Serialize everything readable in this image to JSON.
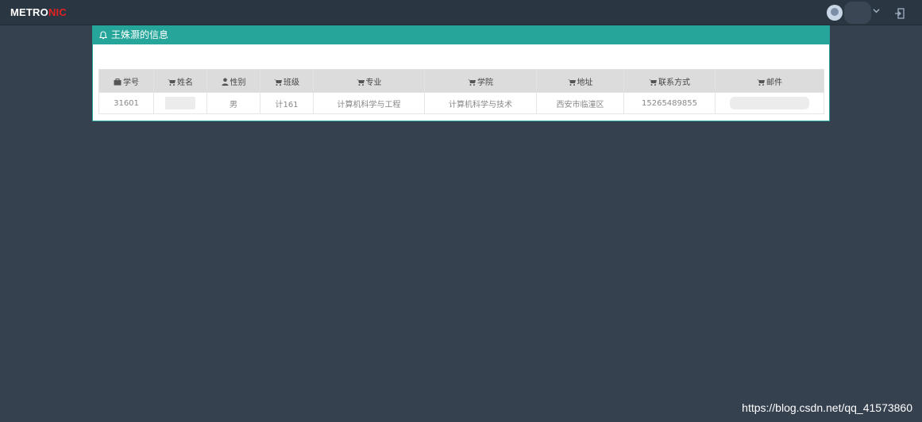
{
  "brand": {
    "logo_part1": "METRO",
    "logo_part2": "NIC",
    "accent_color": "#e02222"
  },
  "header": {
    "avatar_icon": "user-avatar",
    "dropdown_icon": "chevron-down-icon",
    "logout_icon": "logout-icon"
  },
  "panel": {
    "title": "王姝灏的信息",
    "title_icon": "bell-icon",
    "head_color": "#26a69a"
  },
  "table": {
    "columns": [
      {
        "label": "学号",
        "icon": "briefcase-icon"
      },
      {
        "label": "姓名",
        "icon": "cart-icon"
      },
      {
        "label": "性别",
        "icon": "user-icon"
      },
      {
        "label": "班级",
        "icon": "cart-icon"
      },
      {
        "label": "专业",
        "icon": "cart-icon"
      },
      {
        "label": "学院",
        "icon": "cart-icon"
      },
      {
        "label": "地址",
        "icon": "cart-icon"
      },
      {
        "label": "联系方式",
        "icon": "cart-icon"
      },
      {
        "label": "邮件",
        "icon": "cart-icon"
      }
    ],
    "row": {
      "student_id": "31601",
      "name": "",
      "gender": "男",
      "class": "计161",
      "major": "计算机科学与工程",
      "college": "计算机科学与技术",
      "address": "西安市临潼区",
      "phone": "15265489855",
      "email": ""
    }
  },
  "watermark": "https://blog.csdn.net/qq_41573860"
}
